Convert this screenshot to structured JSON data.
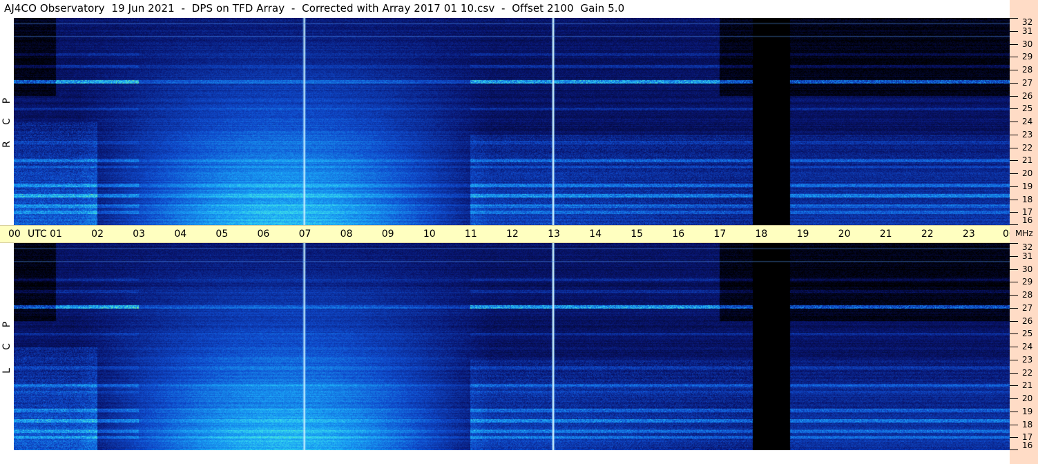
{
  "title": "AJ4CO Observatory  19 Jun 2021  -  DPS on TFD Array  -  Corrected with Array 2017 01 10.csv  -  Offset 2100  Gain 5.0",
  "colors": {
    "time_axis_bg": "#ffffc0",
    "freq_axis_bg": "#ffdcc6",
    "spectrogram_base": "#0a3aa0",
    "spectrogram_bright": "#1aa6ff"
  },
  "chart_data": {
    "type": "heatmap",
    "x_axis": {
      "labels": [
        "00",
        "UTC",
        "01",
        "02",
        "03",
        "04",
        "05",
        "06",
        "07",
        "08",
        "09",
        "10",
        "11",
        "12",
        "13",
        "14",
        "15",
        "16",
        "17",
        "18",
        "19",
        "20",
        "21",
        "22",
        "23",
        "00"
      ],
      "hours": [
        0,
        null,
        1,
        2,
        3,
        4,
        5,
        6,
        7,
        8,
        9,
        10,
        11,
        12,
        13,
        14,
        15,
        16,
        17,
        18,
        19,
        20,
        21,
        22,
        23,
        24
      ],
      "range": [
        0,
        24
      ],
      "unit": "UTC"
    },
    "y_axis": {
      "unit": "MHz",
      "range": [
        16,
        32
      ],
      "tick_labels": [
        "32",
        "31",
        "30",
        "29",
        "28",
        "27",
        "26",
        "25",
        "24",
        "23",
        "22",
        "21",
        "20",
        "19",
        "18",
        "17",
        "16"
      ]
    },
    "panels": [
      {
        "name": "R C P",
        "letters": [
          "P",
          "C",
          "R"
        ]
      },
      {
        "name": "L C P",
        "letters": [
          "P",
          "C",
          "L"
        ]
      }
    ],
    "data_gap_hours": [
      17.8,
      18.7
    ],
    "bright_vertical_lines_hours": [
      7.0,
      13.0
    ],
    "grid": false
  }
}
